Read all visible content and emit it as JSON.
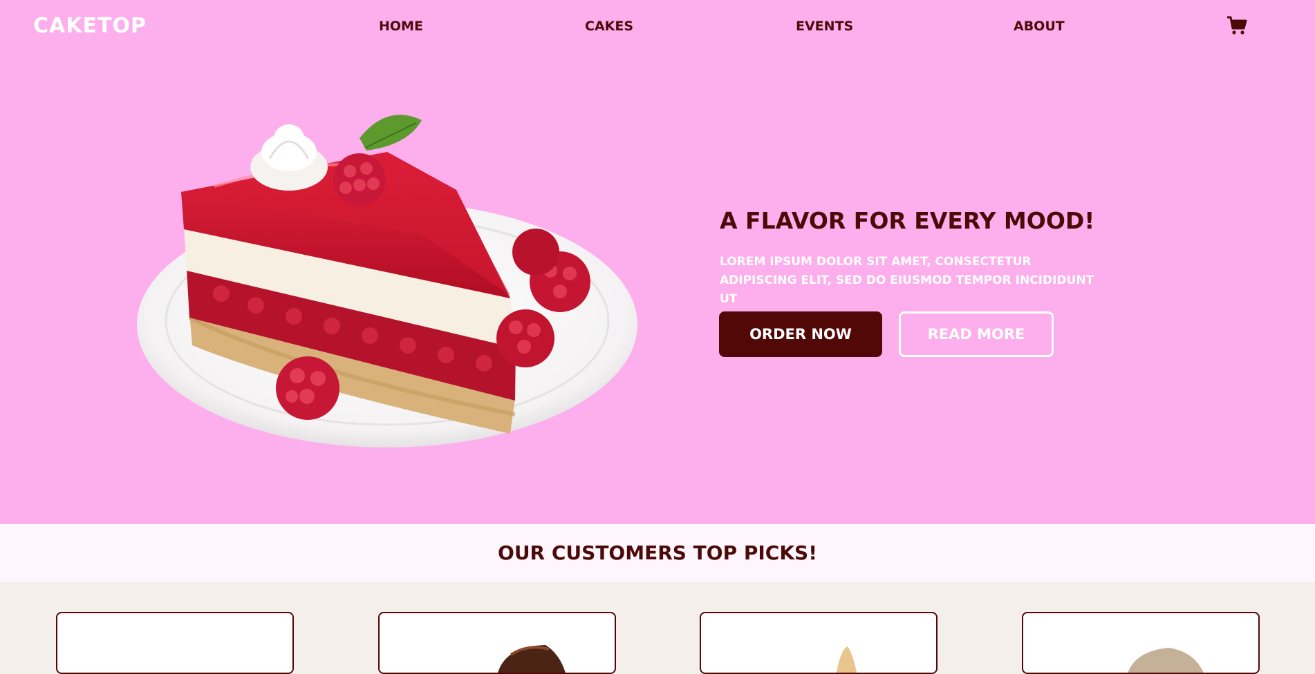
{
  "brand": {
    "logo": "CAKETOP"
  },
  "nav": {
    "items": [
      "HOME",
      "CAKES",
      "EVENTS",
      "ABOUT"
    ]
  },
  "icons": {
    "cart": "shopping-cart-icon"
  },
  "hero": {
    "headline": "A FLAVOR FOR EVERY MOOD!",
    "blurb": "LOREM IPSUM DOLOR SIT AMET, CONSECTETUR ADIPISCING ELIT, SED DO EIUSMOD TEMPOR INCIDIDUNT UT",
    "order_label": "ORDER NOW",
    "read_label": "READ MORE"
  },
  "picks": {
    "title": "OUR CUSTOMERS TOP PICKS!"
  },
  "colors": {
    "hero_bg": "#fdaeec",
    "primary": "#520807",
    "picks_band": "#fff5fc",
    "page_bg": "#f4efea"
  }
}
